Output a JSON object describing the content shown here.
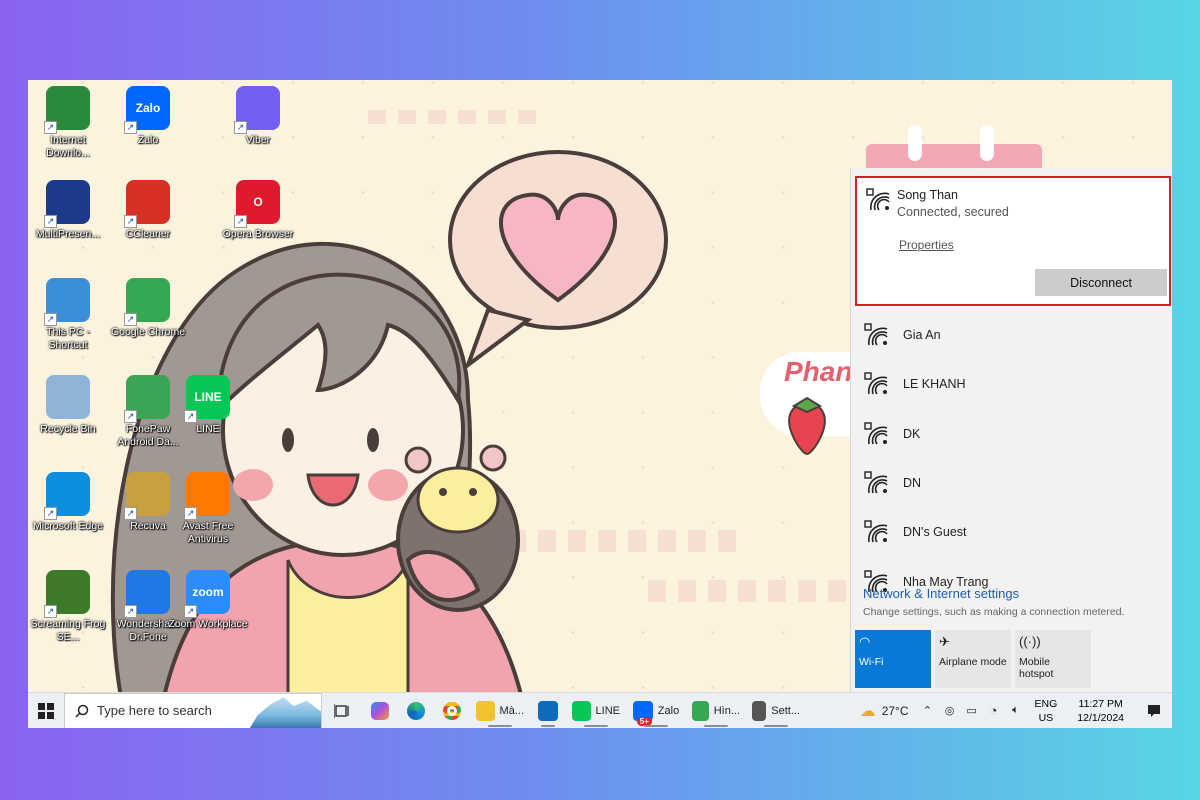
{
  "desktop": {
    "icons": [
      {
        "label": "Internet Downlo...",
        "icon": "internet-download-manager-icon",
        "color": "#2a8a3c"
      },
      {
        "label": "Zalo",
        "icon": "zalo-icon",
        "color": "#0068ff"
      },
      {
        "label": "Viber",
        "icon": "viber-icon",
        "color": "#7360f2"
      },
      {
        "label": "MultiPresen...",
        "icon": "multipresenter-icon",
        "color": "#1b3b8a"
      },
      {
        "label": "CCleaner",
        "icon": "ccleaner-icon",
        "color": "#d93025"
      },
      {
        "label": "Opera Browser",
        "icon": "opera-icon",
        "color": "#e0192d"
      },
      {
        "label": "This PC - Shortcut",
        "icon": "this-pc-icon",
        "color": "#3a8fd8"
      },
      {
        "label": "Google Chrome",
        "icon": "chrome-icon",
        "color": "#34a853"
      },
      {
        "label": "Recycle Bin",
        "icon": "recycle-bin-icon",
        "color": "#8fb4d8"
      },
      {
        "label": "FonePaw Android Da...",
        "icon": "fonepaw-icon",
        "color": "#3aa655"
      },
      {
        "label": "LINE",
        "icon": "line-icon",
        "color": "#06c755"
      },
      {
        "label": "Microsoft Edge",
        "icon": "edge-icon",
        "color": "#0c8fdc"
      },
      {
        "label": "Recuva",
        "icon": "recuva-icon",
        "color": "#c8a040"
      },
      {
        "label": "Avast Free Antivirus",
        "icon": "avast-icon",
        "color": "#ff7800"
      },
      {
        "label": "Screaming Frog SE...",
        "icon": "screaming-frog-icon",
        "color": "#3c7a2a"
      },
      {
        "label": "Wondershare Dr.Fone",
        "icon": "drfone-icon",
        "color": "#1e78e6"
      },
      {
        "label": "Zoom Workplace",
        "icon": "zoom-icon",
        "color": "#2d8cff"
      }
    ],
    "icon_text": {
      "zalo": "Zalo",
      "line": "LINE",
      "zoom": "zoom",
      "opera": "O"
    },
    "wallpaper_text": "Phan"
  },
  "wifi": {
    "active": {
      "ssid": "Song  Than",
      "status": "Connected, secured",
      "properties_label": "Properties",
      "disconnect_label": "Disconnect"
    },
    "networks": [
      "Gia An",
      "LE KHANH",
      "DK",
      "DN",
      "DN's Guest",
      "Nha May Trang"
    ],
    "settings_title": "Network & Internet settings",
    "settings_sub": "Change settings, such as making a connection metered.",
    "quick_actions": [
      {
        "label": "Wi-Fi",
        "icon": "wifi-icon",
        "on": true
      },
      {
        "label": "Airplane mode",
        "icon": "airplane-icon",
        "on": false
      },
      {
        "label": "Mobile hotspot",
        "icon": "hotspot-icon",
        "on": false
      }
    ],
    "accent": "#0a79d6",
    "highlight": "#d32027"
  },
  "taskbar": {
    "search_placeholder": "Type here to search",
    "apps": [
      {
        "label": "Mà...",
        "icon": "file-explorer-icon",
        "color": "#f2c12e"
      },
      {
        "label": "",
        "icon": "outlook-icon",
        "color": "#0f6cbd"
      },
      {
        "label": "LINE",
        "icon": "line-icon",
        "color": "#06c755"
      },
      {
        "label": "Zalo",
        "icon": "zalo-icon",
        "color": "#0068ff",
        "badge": "5+"
      },
      {
        "label": "Hìn...",
        "icon": "chrome-icon",
        "color": "#34a853"
      },
      {
        "label": "Sett...",
        "icon": "settings-icon",
        "color": "#555555"
      }
    ],
    "weather": "27°C",
    "lang_top": "ENG",
    "lang_bottom": "US",
    "time": "11:27 PM",
    "date": "12/1/2024"
  }
}
